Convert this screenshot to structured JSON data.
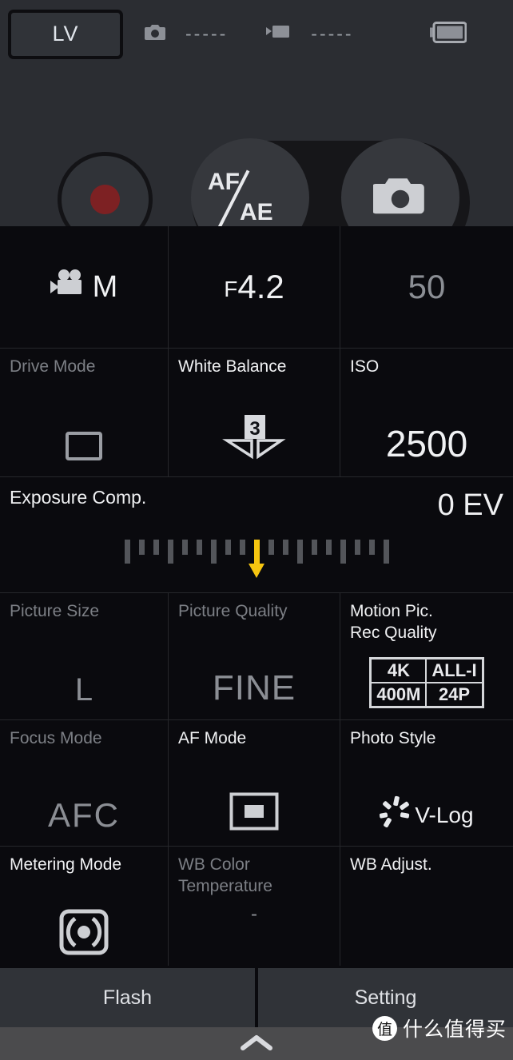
{
  "statusbar": {
    "lv_label": "LV",
    "still_icon": "camera-icon",
    "still_remaining": "-----",
    "video_icon": "video-camera-icon",
    "video_remaining": "-----",
    "battery_icon": "battery-icon"
  },
  "controls": {
    "record_label": "record-button",
    "af_text": "AF",
    "ae_text": "AE",
    "shutter_icon": "camera-icon"
  },
  "grid": {
    "row_top": {
      "rec_mode": {
        "icon": "movie-camera-icon",
        "value": "M"
      },
      "aperture": {
        "prefix": "F",
        "value": "4.2"
      },
      "shutter": {
        "value": "50"
      }
    },
    "row_2": [
      {
        "label": "Drive Mode",
        "dim": true,
        "value_icon": "single-frame-icon"
      },
      {
        "label": "White Balance",
        "dim": false,
        "value_icon": "wb-preset-3-icon",
        "value": "3"
      },
      {
        "label": "ISO",
        "dim": false,
        "value": "2500"
      }
    ],
    "exposure": {
      "label": "Exposure Comp.",
      "value": "0 EV",
      "ticks": [
        "tall",
        "short",
        "short",
        "tall",
        "short",
        "short",
        "tall",
        "short",
        "short",
        "cur",
        "short",
        "short",
        "tall",
        "short",
        "short",
        "tall",
        "short",
        "short",
        "tall"
      ],
      "marker_position": 0
    },
    "row_3": [
      {
        "label": "Picture Size",
        "dim": true,
        "value": "L"
      },
      {
        "label": "Picture Quality",
        "dim": true,
        "value": "FINE"
      },
      {
        "label": "Motion Pic.\nRec Quality",
        "dim": false,
        "rec_quality": [
          "4K",
          "ALL-I",
          "400M",
          "24P"
        ]
      }
    ],
    "row_4": [
      {
        "label": "Focus Mode",
        "dim": true,
        "value": "AFC"
      },
      {
        "label": "AF Mode",
        "dim": false,
        "value_icon": "af-area-1area-icon"
      },
      {
        "label": "Photo Style",
        "dim": false,
        "value": "V-Log",
        "value_icon": "sunburst-icon"
      }
    ],
    "row_5": [
      {
        "label": "Metering Mode",
        "dim": false,
        "value_icon": "center-weighted-metering-icon"
      },
      {
        "label": "WB Color\nTemperature",
        "dim": true,
        "value": "-"
      },
      {
        "label": "WB Adjust.",
        "dim": false,
        "value": ""
      }
    ]
  },
  "bottom": {
    "flash_label": "Flash",
    "setting_label": "Setting",
    "nav_chevron": "chevron-up-icon"
  },
  "watermark": {
    "logo": "值",
    "text": "什么值得买"
  }
}
